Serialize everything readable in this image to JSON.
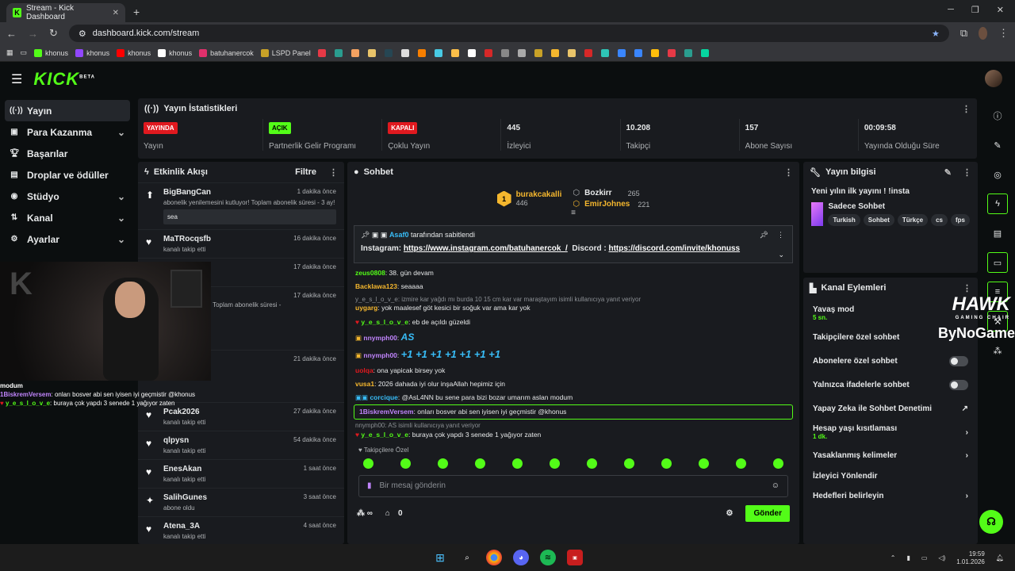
{
  "browser": {
    "tab_title": "Stream - Kick Dashboard",
    "url": "dashboard.kick.com/stream",
    "bookmarks": [
      "khonus",
      "khonus",
      "khonus",
      "khonus",
      "batuhanercok",
      "LSPD Panel"
    ]
  },
  "header": {
    "logo": "KICK",
    "logo_sup": "BETA"
  },
  "sidebar": {
    "items": [
      {
        "label": "Yayın",
        "icon": "broadcast-icon",
        "active": true
      },
      {
        "label": "Para Kazanma",
        "icon": "money-icon",
        "chevron": true
      },
      {
        "label": "Başarılar",
        "icon": "trophy-icon"
      },
      {
        "label": "Droplar ve ödüller",
        "icon": "gift-icon"
      },
      {
        "label": "Stüdyo",
        "icon": "studio-icon",
        "chevron": true
      },
      {
        "label": "Kanal",
        "icon": "channel-icon",
        "chevron": true
      },
      {
        "label": "Ayarlar",
        "icon": "gear-icon",
        "chevron": true
      }
    ]
  },
  "stats": {
    "title": "Yayın İstatistikleri",
    "items": [
      {
        "badge": "YAYINDA",
        "badge_color": "#e0191f",
        "label": "Yayın"
      },
      {
        "badge": "AÇIK",
        "badge_color": "#53fc18",
        "label": "Partnerlik Gelir Programı"
      },
      {
        "badge": "KAPALI",
        "badge_color": "#e0191f",
        "label": "Çoklu Yayın"
      },
      {
        "value": "445",
        "label": "İzleyici"
      },
      {
        "value": "10.208",
        "label": "Takipçi"
      },
      {
        "value": "157",
        "label": "Abone Sayısı"
      },
      {
        "value": "00:09:58",
        "label": "Yayında Olduğu Süre"
      }
    ]
  },
  "activity": {
    "title": "Etkinlik Akışı",
    "filter": "Filtre",
    "items": [
      {
        "name": "BigBangCan",
        "time": "1 dakika önce",
        "sub": "abonelik yenilemesini kutluyor! Toplam abonelik süresi - 3 ay!",
        "msg": "sea",
        "icon": "sub-icon"
      },
      {
        "name": "MaTRocqsfb",
        "time": "16 dakika önce",
        "sub": "kanalı takip etti",
        "icon": "heart-icon"
      },
      {
        "name": "",
        "time": "17 dakika önce",
        "sub": "",
        "icon": "heart-icon"
      },
      {
        "name": "",
        "time": "17 dakika önce",
        "sub": "emesini kutluyor! Toplam abonelik süresi -",
        "icon": "sub-icon"
      },
      {
        "name": "",
        "time": "21 dakika önce",
        "sub": "",
        "icon": "sub-icon"
      },
      {
        "name": "Pcak2026",
        "time": "27 dakika önce",
        "sub": "kanalı takip etti",
        "icon": "heart-icon"
      },
      {
        "name": "qlpysn",
        "time": "54 dakika önce",
        "sub": "kanalı takip etti",
        "icon": "heart-icon"
      },
      {
        "name": "EnesAkan",
        "time": "1 saat önce",
        "sub": "kanalı takip etti",
        "icon": "heart-icon"
      },
      {
        "name": "SalihGunes",
        "time": "3 saat önce",
        "sub": "abone oldu",
        "icon": "sparkle-icon"
      },
      {
        "name": "Atena_3A",
        "time": "4 saat önce",
        "sub": "kanalı takip etti",
        "icon": "heart-icon"
      }
    ]
  },
  "chat": {
    "title": "Sohbet",
    "leaders": [
      {
        "rank": "1",
        "name": "burakcakalli",
        "value": "446",
        "color": "#f5b72e"
      },
      {
        "name": "Bozkirr",
        "value": "265",
        "color": "#e7e9ea"
      },
      {
        "name": "EmirJohnes",
        "value": "221",
        "color": "#f5b72e"
      }
    ],
    "pinned_by": "Asaf0",
    "pinned_suffix": "tarafından sabitlendi",
    "pinned_label1": "Instagram:",
    "pinned_link1": "https://www.instagram.com/batuhanercok_/",
    "pinned_label2": "Discord :",
    "pinned_link2": "https://discord.com/invite/khonuss",
    "messages": [
      {
        "user": "zeus0808",
        "color": "#53fc18",
        "text": "38. gün devam"
      },
      {
        "user": "Backlawa123",
        "color": "#f5b72e",
        "text": "seaaaa"
      },
      {
        "reply": "y_e_s_l_o_v_e: izmire kar yağdı mı burda 10 15 cm kar var maraştayım isimli kullanıcıya yanıt veriyor",
        "user": "uygarg",
        "color": "#f5b72e",
        "text": "yok maalesef göt kesici bir soğuk var ama kar yok"
      },
      {
        "user": "y_e_s_l_o_v_e",
        "color": "#53fc18",
        "text": "eb de açıldı güzeldi"
      },
      {
        "user": "nnymph00",
        "color": "#c084fc",
        "text": "AS"
      },
      {
        "user": "nnymph00",
        "color": "#c084fc",
        "text": "+1 +1 +1 +1 +1 +1 +1"
      },
      {
        "user": "uolqa",
        "color": "#e0191f",
        "text": "ona yapicak birsey yok"
      },
      {
        "user": "vusa1",
        "color": "#f5b72e",
        "text": "2026 dahada iyi olur inşaAllah hepimiz için"
      },
      {
        "user": "corcique",
        "color": "#38bdf8",
        "text": "@AsL4NN bu sene para bizi bozar umarım aslan modum"
      },
      {
        "user": "1BiskremVersem",
        "color": "#c084fc",
        "text": "onları bosver abi sen iyisen iyi geçmistir @khonus",
        "highlight": true
      },
      {
        "reply": "nnymph00: AS isimli kullanıcıya yanıt veriyor",
        "user": "y_e_s_l_o_v_e",
        "color": "#53fc18",
        "text": "buraya çok yapdı 3 senede 1 yağıyor zaten"
      }
    ],
    "followers_only": "Takipçilere Özel",
    "input_placeholder": "Bir mesaj gönderin",
    "points": "0",
    "send_label": "Gönder"
  },
  "stream_info": {
    "title": "Yayın bilgisi",
    "stream_title": "Yeni yılın ilk yayını ! !insta",
    "category": "Sadece Sohbet",
    "tags": [
      "Turkish",
      "Sohbet",
      "Türkçe",
      "cs",
      "fps"
    ]
  },
  "channel_actions": {
    "title": "Kanal Eylemleri",
    "rows": [
      {
        "label": "Yavaş mod",
        "sub": "5 sn."
      },
      {
        "label": "Takipçilere özel sohbet"
      },
      {
        "label": "Abonelere özel sohbet",
        "toggle": true
      },
      {
        "label": "Yalnızca ifadelerle sohbet",
        "toggle": true
      },
      {
        "label": "Yapay Zeka ile Sohbet Denetimi",
        "ext": true
      },
      {
        "label": "Hesap yaşı kısıtlaması",
        "sub": "1 dk.",
        "chevron": true
      },
      {
        "label": "Yasaklanmış kelimeler",
        "chevron": true
      },
      {
        "label": "İzleyici Yönlendir"
      },
      {
        "label": "Hedefleri belirleyin",
        "chevron": true
      }
    ]
  },
  "overlay": {
    "chat_lines": [
      {
        "text": "modum"
      },
      {
        "user": "1BiskremVersem",
        "text": ": onları bosver abi sen iyisen iyi geçmistir @khonus"
      },
      {
        "user": "y_e_s_l_o_v_e",
        "text": ": buraya çok yapdı 3 senede 1 yağıyor zaten"
      }
    ],
    "sponsor1": "HAWK",
    "sponsor1_sub": "GAMING CHAIR",
    "sponsor2": "ByNoGame"
  },
  "taskbar": {
    "time": "19:59",
    "date": "1.01.2026"
  }
}
